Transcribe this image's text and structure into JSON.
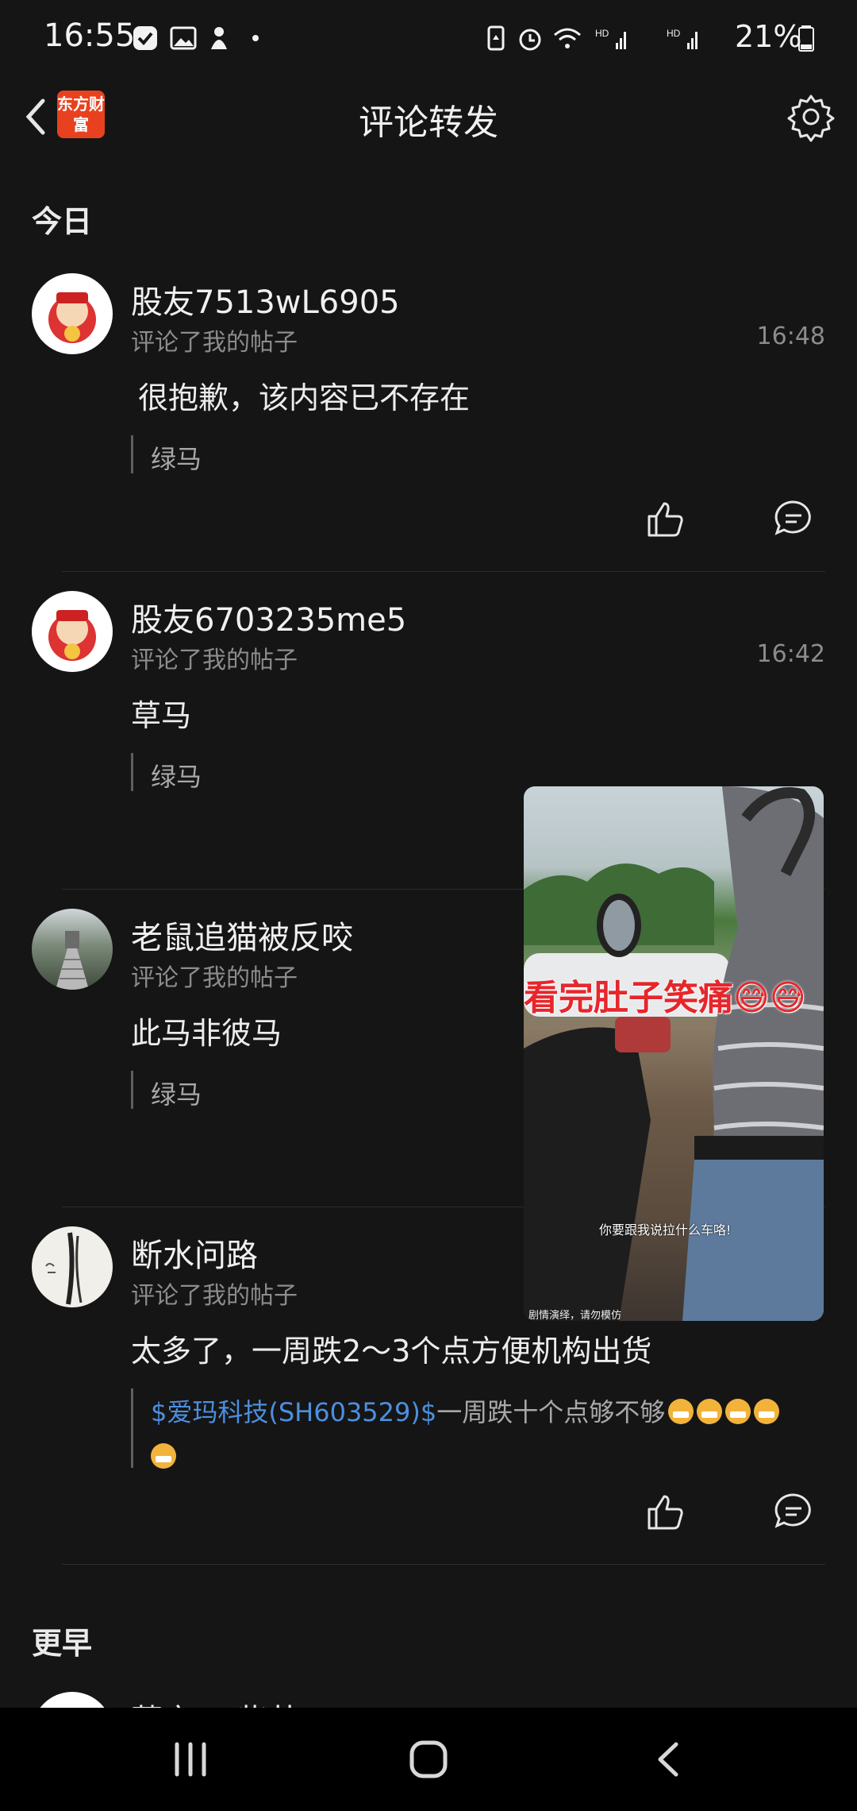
{
  "status_bar": {
    "time": "16:55",
    "battery": "21%"
  },
  "header": {
    "title": "评论转发",
    "logo_text": "东方财富"
  },
  "sections": {
    "today": "今日",
    "earlier": "更早"
  },
  "comments": [
    {
      "user": "股友7513wL6905",
      "action": "评论了我的帖子",
      "time": "16:48",
      "text": "很抱歉，该内容已不存在",
      "quote": "绿马"
    },
    {
      "user": "股友6703235me5",
      "action": "评论了我的帖子",
      "time": "16:42",
      "text": "草马",
      "quote": "绿马"
    },
    {
      "user": "老鼠追猫被反咬",
      "action": "评论了我的帖子",
      "time": "",
      "text": "此马非彼马",
      "quote": "绿马"
    },
    {
      "user": "断水问路",
      "action": "评论了我的帖子",
      "time": "",
      "text": "太多了，一周跌2～3个点方便机构出货",
      "quote_link": "$爱玛科技(SH603529)$",
      "quote_rest": "一周跌十个点够不够"
    }
  ],
  "partial_next_user": "莫宠XS柴茶",
  "video": {
    "caption": "看完肚子笑痛😅😅",
    "subtitle": "你要跟我说拉什么车咯!",
    "watermark": "剧情演绎，请勿模仿"
  },
  "icons": [
    "back-chevron-icon",
    "logo-icon",
    "settings-gear-icon",
    "like-thumb-icon",
    "reply-bubble-icon"
  ]
}
